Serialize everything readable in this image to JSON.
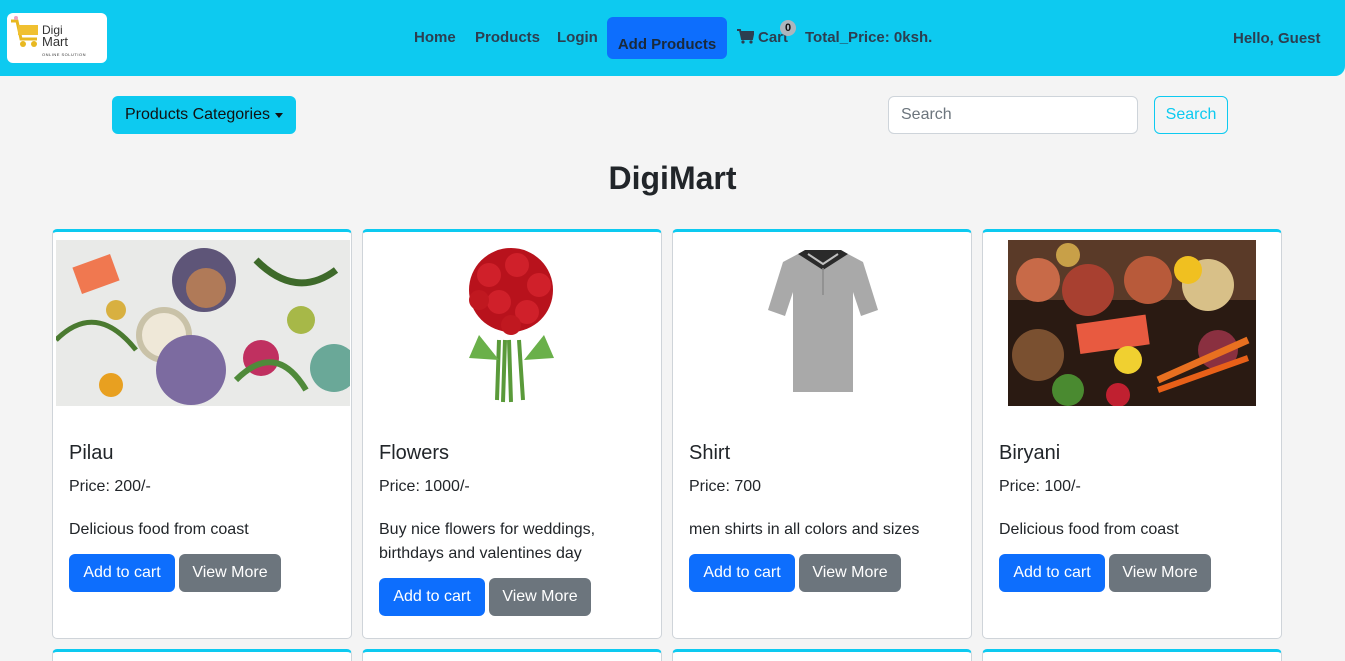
{
  "brand": {
    "line1": "Digi",
    "line2": "Mart",
    "tagline": "ONLINE SOLUTION"
  },
  "nav": {
    "home": "Home",
    "products": "Products",
    "login": "Login",
    "add_products": "Add Products",
    "cart": "Cart",
    "cart_count": "0",
    "total_price": "Total_Price: 0ksh.",
    "greeting": "Hello, Guest"
  },
  "toolbar": {
    "categories_label": "Products Categories",
    "search_placeholder": "Search",
    "search_button": "Search"
  },
  "page_title": "DigiMart",
  "products": [
    {
      "name": "Pilau",
      "price": "Price: 200/-",
      "description": "Delicious food from coast",
      "add_label": "Add to cart",
      "more_label": "View More"
    },
    {
      "name": "Flowers",
      "price": "Price: 1000/-",
      "description": "Buy nice flowers for weddings, birthdays and valentines day",
      "add_label": "Add to cart",
      "more_label": "View More"
    },
    {
      "name": "Shirt",
      "price": "Price: 700",
      "description": "men shirts in all colors and sizes",
      "add_label": "Add to cart",
      "more_label": "View More"
    },
    {
      "name": "Biryani",
      "price": "Price: 100/-",
      "description": "Delicious food from coast",
      "add_label": "Add to cart",
      "more_label": "View More"
    }
  ],
  "colors": {
    "navbar": "#0dcaf0",
    "primary": "#0d6efd",
    "secondary": "#6c757d",
    "background": "#f4f4f4"
  }
}
